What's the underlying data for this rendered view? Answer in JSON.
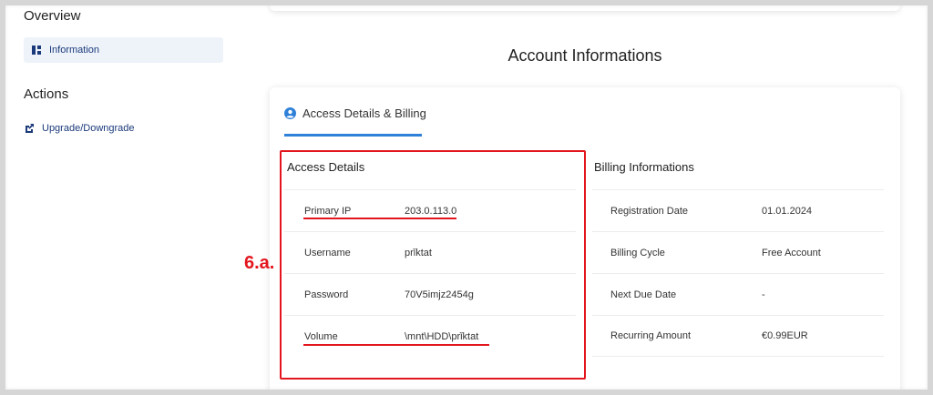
{
  "sidebar": {
    "overview_heading": "Overview",
    "information_label": "Information",
    "actions_heading": "Actions",
    "upgrade_label": "Upgrade/Downgrade"
  },
  "main": {
    "page_title": "Account Informations",
    "tab_label": "Access Details & Billing"
  },
  "access_details": {
    "title": "Access Details",
    "rows": [
      {
        "label": "Primary IP",
        "value": "203.0.113.0"
      },
      {
        "label": "Username",
        "value": "prǐktat"
      },
      {
        "label": "Password",
        "value": "70V5imjz2454g"
      },
      {
        "label": "Volume",
        "value": "\\mnt\\HDD\\prǐktat"
      }
    ]
  },
  "billing": {
    "title": "Billing Informations",
    "rows": [
      {
        "label": "Registration Date",
        "value": "01.01.2024"
      },
      {
        "label": "Billing Cycle",
        "value": "Free Account"
      },
      {
        "label": "Next Due Date",
        "value": "-"
      },
      {
        "label": "Recurring Amount",
        "value": "€0.99EUR"
      }
    ]
  },
  "annotation": {
    "label": "6.a.",
    "color": "#e3161e"
  },
  "colors": {
    "accent": "#2f80d8",
    "sidebar_active_bg": "#eef3fa",
    "link": "#1a3a7a"
  }
}
